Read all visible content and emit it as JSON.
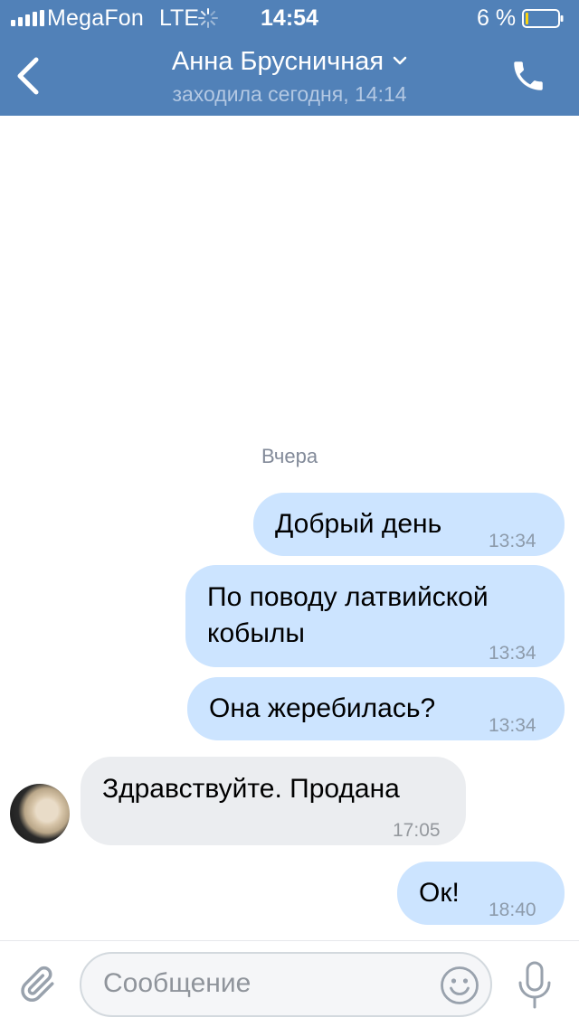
{
  "status_bar": {
    "carrier": "MegaFon",
    "network": "LTE",
    "time": "14:54",
    "battery_percent": "6 %",
    "battery_level": 0.06
  },
  "header": {
    "title": "Анна Брусничная",
    "subtitle": "заходила сегодня, 14:14",
    "accent_color": "#5181b8"
  },
  "chat": {
    "date_separator": "Вчера",
    "messages": [
      {
        "direction": "outgoing",
        "text": "Добрый день",
        "time": "13:34"
      },
      {
        "direction": "outgoing",
        "text": "По поводу латвийской кобылы",
        "time": "13:34"
      },
      {
        "direction": "outgoing",
        "text": "Она жеребилась?",
        "time": "13:34"
      },
      {
        "direction": "incoming",
        "text": "Здравствуйте. Продана",
        "time": "17:05"
      },
      {
        "direction": "outgoing",
        "text": "Ок!",
        "time": "18:40"
      }
    ]
  },
  "composer": {
    "placeholder": "Сообщение"
  },
  "icons": [
    "signal-icon",
    "loading-icon",
    "battery-icon",
    "back-icon",
    "chevron-down-icon",
    "phone-icon",
    "attach-icon",
    "emoji-icon",
    "microphone-icon"
  ]
}
